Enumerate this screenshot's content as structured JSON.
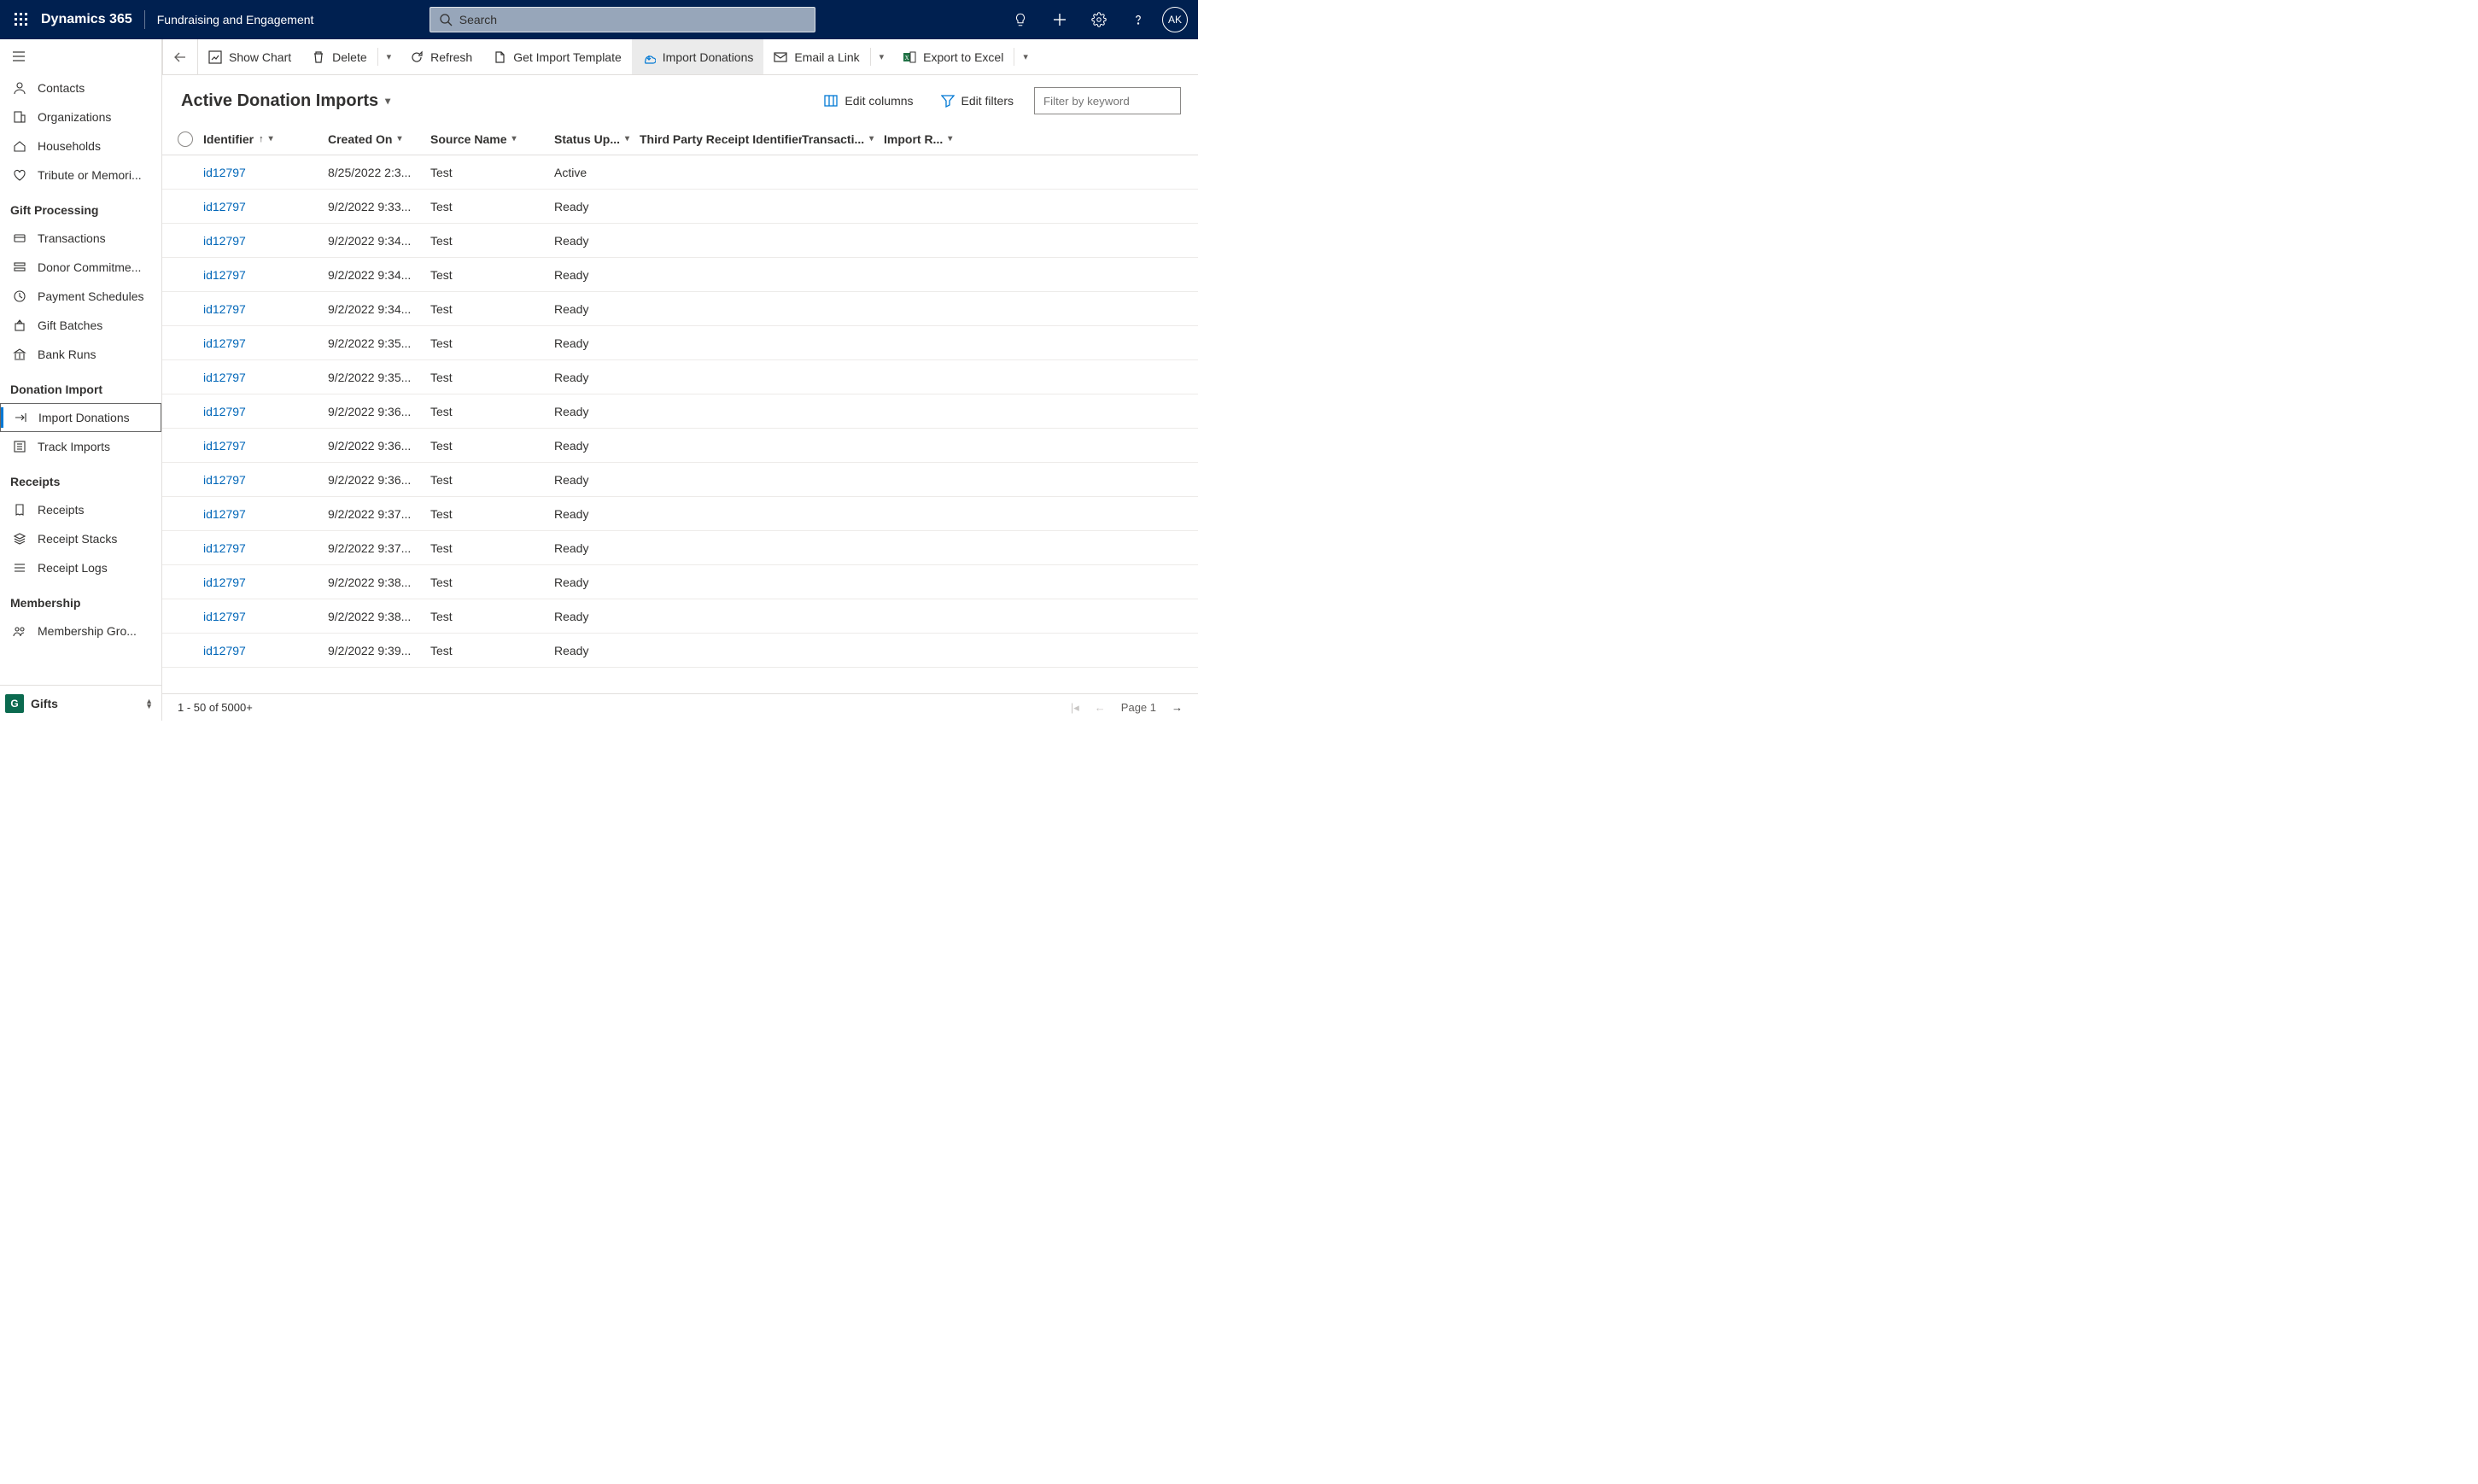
{
  "header": {
    "product": "Dynamics 365",
    "module": "Fundraising and Engagement",
    "search_placeholder": "Search",
    "avatar_initials": "AK"
  },
  "sidebar": {
    "groups": [
      {
        "title": null,
        "items": [
          {
            "icon": "contact",
            "label": "Contacts"
          },
          {
            "icon": "org",
            "label": "Organizations"
          },
          {
            "icon": "house",
            "label": "Households"
          },
          {
            "icon": "heart",
            "label": "Tribute or Memori..."
          }
        ]
      },
      {
        "title": "Gift Processing",
        "items": [
          {
            "icon": "txn",
            "label": "Transactions"
          },
          {
            "icon": "commit",
            "label": "Donor Commitme..."
          },
          {
            "icon": "sched",
            "label": "Payment Schedules"
          },
          {
            "icon": "batch",
            "label": "Gift Batches"
          },
          {
            "icon": "bank",
            "label": "Bank Runs"
          }
        ]
      },
      {
        "title": "Donation Import",
        "items": [
          {
            "icon": "import",
            "label": "Import Donations",
            "selected": true
          },
          {
            "icon": "track",
            "label": "Track Imports"
          }
        ]
      },
      {
        "title": "Receipts",
        "items": [
          {
            "icon": "receipt",
            "label": "Receipts"
          },
          {
            "icon": "stack",
            "label": "Receipt Stacks"
          },
          {
            "icon": "log",
            "label": "Receipt Logs"
          }
        ]
      },
      {
        "title": "Membership",
        "items": [
          {
            "icon": "member",
            "label": "Membership Gro..."
          }
        ]
      }
    ],
    "area": {
      "badge": "G",
      "label": "Gifts"
    }
  },
  "command_bar": {
    "buttons": [
      {
        "id": "show-chart",
        "label": "Show Chart"
      },
      {
        "id": "delete",
        "label": "Delete",
        "has_chevron": true
      },
      {
        "id": "refresh",
        "label": "Refresh"
      },
      {
        "id": "get-template",
        "label": "Get Import Template"
      },
      {
        "id": "import-donations",
        "label": "Import Donations",
        "active": true
      },
      {
        "id": "email-link",
        "label": "Email a Link",
        "has_chevron": true
      },
      {
        "id": "export-excel",
        "label": "Export to Excel",
        "has_chevron": true
      }
    ]
  },
  "view": {
    "title": "Active Donation Imports",
    "edit_columns": "Edit columns",
    "edit_filters": "Edit filters",
    "filter_placeholder": "Filter by keyword"
  },
  "grid": {
    "columns": [
      {
        "key": "identifier",
        "label": "Identifier",
        "sort": "asc"
      },
      {
        "key": "created",
        "label": "Created On"
      },
      {
        "key": "source",
        "label": "Source Name"
      },
      {
        "key": "status",
        "label": "Status Up..."
      },
      {
        "key": "receipt",
        "label": "Third Party Receipt Identifier"
      },
      {
        "key": "txn",
        "label": "Transacti..."
      },
      {
        "key": "ir",
        "label": "Import R..."
      }
    ],
    "rows": [
      {
        "identifier": "id12797",
        "created": "8/25/2022 2:3...",
        "source": "Test",
        "status": "Active"
      },
      {
        "identifier": "id12797",
        "created": "9/2/2022 9:33...",
        "source": "Test",
        "status": "Ready"
      },
      {
        "identifier": "id12797",
        "created": "9/2/2022 9:34...",
        "source": "Test",
        "status": "Ready"
      },
      {
        "identifier": "id12797",
        "created": "9/2/2022 9:34...",
        "source": "Test",
        "status": "Ready"
      },
      {
        "identifier": "id12797",
        "created": "9/2/2022 9:34...",
        "source": "Test",
        "status": "Ready"
      },
      {
        "identifier": "id12797",
        "created": "9/2/2022 9:35...",
        "source": "Test",
        "status": "Ready"
      },
      {
        "identifier": "id12797",
        "created": "9/2/2022 9:35...",
        "source": "Test",
        "status": "Ready"
      },
      {
        "identifier": "id12797",
        "created": "9/2/2022 9:36...",
        "source": "Test",
        "status": "Ready"
      },
      {
        "identifier": "id12797",
        "created": "9/2/2022 9:36...",
        "source": "Test",
        "status": "Ready"
      },
      {
        "identifier": "id12797",
        "created": "9/2/2022 9:36...",
        "source": "Test",
        "status": "Ready"
      },
      {
        "identifier": "id12797",
        "created": "9/2/2022 9:37...",
        "source": "Test",
        "status": "Ready"
      },
      {
        "identifier": "id12797",
        "created": "9/2/2022 9:37...",
        "source": "Test",
        "status": "Ready"
      },
      {
        "identifier": "id12797",
        "created": "9/2/2022 9:38...",
        "source": "Test",
        "status": "Ready"
      },
      {
        "identifier": "id12797",
        "created": "9/2/2022 9:38...",
        "source": "Test",
        "status": "Ready"
      },
      {
        "identifier": "id12797",
        "created": "9/2/2022 9:39...",
        "source": "Test",
        "status": "Ready"
      }
    ]
  },
  "status": {
    "range": "1 - 50 of 5000+",
    "page_label": "Page 1"
  }
}
